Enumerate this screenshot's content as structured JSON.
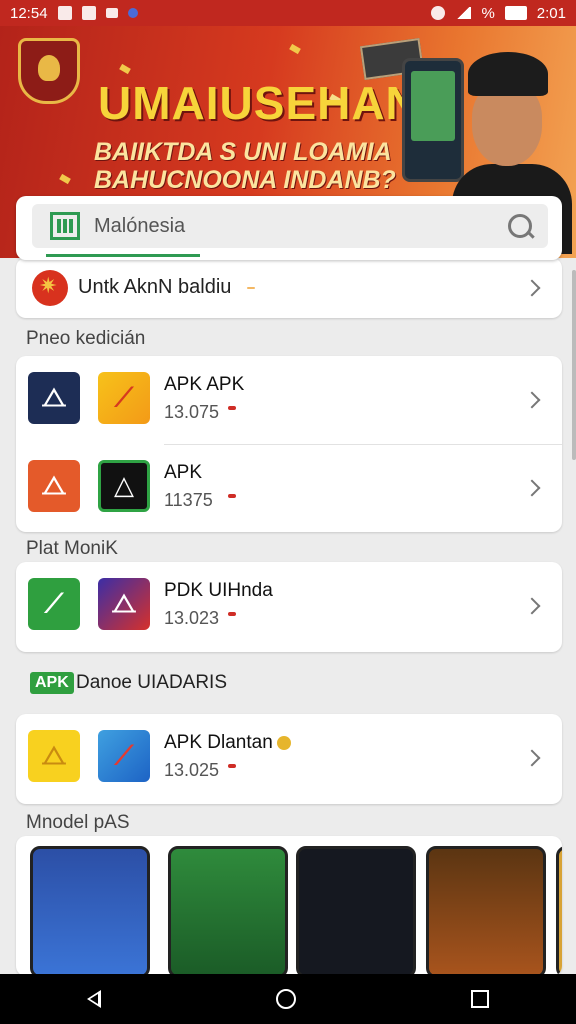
{
  "status_bar": {
    "left_text": "12:54",
    "battery": "%",
    "time": "2:01"
  },
  "banner": {
    "title": "UMAIUSEHAN",
    "subtitle_1": "BAIIKTDA S UNI LOAMIA",
    "subtitle_2": "BAHUCNOONA INDANB?"
  },
  "search": {
    "placeholder": "Malónesia"
  },
  "featured": {
    "label": "Untk AknN baldiu",
    "tag": ""
  },
  "sections": {
    "popular_title": "Pneo kedicián",
    "plat_title": "Plat MoniK",
    "dance_badge": "APK",
    "dance_title": "Danoe UIADARIS",
    "more_title": "Mnodel pAS"
  },
  "apps": {
    "row1": {
      "name": "APK APK",
      "version": "13.075",
      "tag": ""
    },
    "row2": {
      "name": "APK",
      "version": "11375",
      "tag": ""
    },
    "row3": {
      "name": "PDK UIHnda",
      "version": "13.023",
      "tag": ""
    },
    "row4": {
      "name": "APK Dlantan",
      "version": "13.025",
      "tag": ""
    }
  },
  "icons": {
    "emblem": "garuda-emblem-icon",
    "search": "search-icon",
    "store": "store-icon",
    "chevron": "chevron-right-icon"
  },
  "colors": {
    "banner_red": "#c0281f",
    "accent_green": "#2e9a52",
    "tag_red": "#cf2d26",
    "title_yellow": "#f7d43a"
  }
}
